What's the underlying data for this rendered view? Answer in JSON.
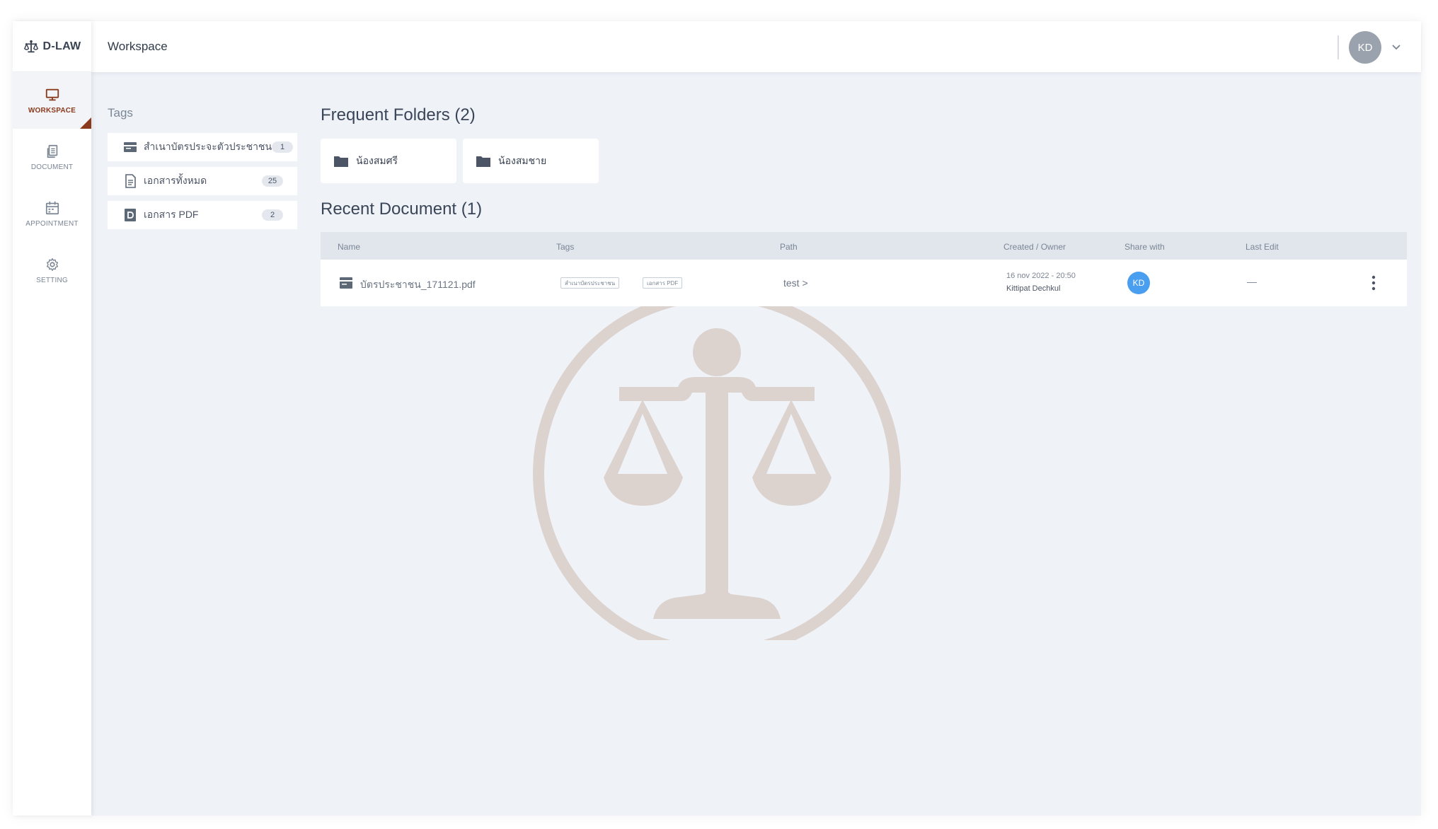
{
  "app": {
    "name": "D-LAW"
  },
  "header": {
    "title": "Workspace",
    "avatar_initials": "KD"
  },
  "sidebar": {
    "items": [
      {
        "label": "WORKSPACE",
        "icon": "monitor-icon",
        "active": true
      },
      {
        "label": "DOCUMENT",
        "icon": "documents-icon",
        "active": false
      },
      {
        "label": "APPOINTMENT",
        "icon": "calendar-icon",
        "active": false
      },
      {
        "label": "SETTING",
        "icon": "gear-icon",
        "active": false
      }
    ]
  },
  "tags": {
    "title": "Tags",
    "items": [
      {
        "label": "สำเนาบัตรประจะตัวประชาชน",
        "count": "1",
        "icon": "id-card-icon"
      },
      {
        "label": "เอกสารทั้งหมด",
        "count": "25",
        "icon": "document-icon"
      },
      {
        "label": "เอกสาร PDF",
        "count": "2",
        "icon": "pdf-icon"
      }
    ]
  },
  "frequent_folders": {
    "title": "Frequent Folders (2)",
    "items": [
      {
        "label": "น้องสมศรี",
        "icon": "folder-icon"
      },
      {
        "label": "น้องสมชาย",
        "icon": "folder-icon"
      }
    ]
  },
  "recent_documents": {
    "title": "Recent Document (1)",
    "columns": [
      "Name",
      "Tags",
      "Path",
      "Created / Owner",
      "Share with",
      "Last Edit"
    ],
    "rows": [
      {
        "name": "บัตรประชาชน_171121.pdf",
        "tags": [
          "สำเนาบัตรประชาชน",
          "เอกสาร PDF"
        ],
        "path": "test >",
        "created": "16 nov 2022 - 20:50",
        "owner": "Kittipat Dechkul",
        "share_with": "KD",
        "last_edit": "—"
      }
    ]
  },
  "colors": {
    "accent": "#8a3a1c",
    "background": "#eff3f8",
    "share_avatar": "#4a9ef0",
    "watermark": "#dcd3cf"
  }
}
